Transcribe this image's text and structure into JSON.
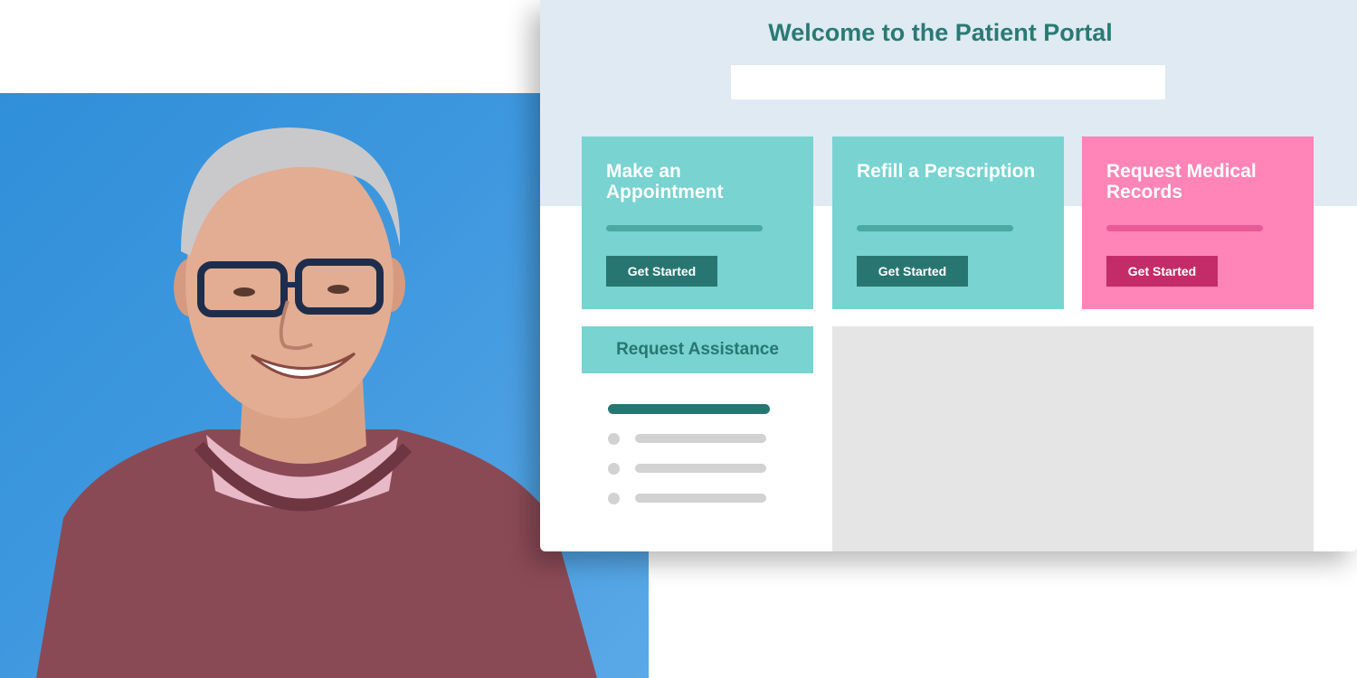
{
  "portal": {
    "title": "Welcome to the Patient Portal",
    "search_value": "",
    "cards": [
      {
        "title": "Make an Appointment",
        "button": "Get Started",
        "color": "#78d3d1"
      },
      {
        "title": "Refill a Perscription",
        "button": "Get Started",
        "color": "#78d3d1"
      },
      {
        "title": "Request Medical Records",
        "button": "Get Started",
        "color": "#ff84b7"
      }
    ],
    "assistance": {
      "label": "Request Assistance"
    }
  },
  "colors": {
    "accent_teal": "#78d3d1",
    "dark_teal": "#287672",
    "accent_pink": "#ff84b7",
    "dark_pink": "#c32c69",
    "header_band": "#dfeaf3",
    "photo_background": "#3a96dd"
  }
}
